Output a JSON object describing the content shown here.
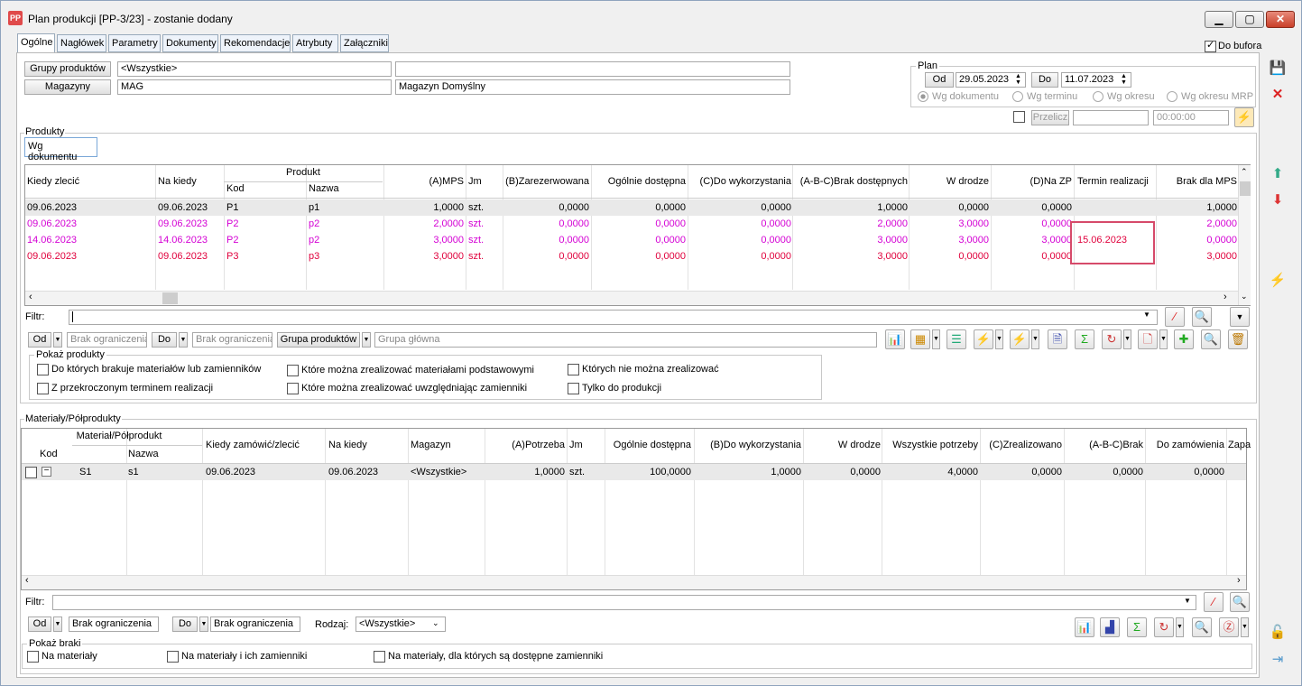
{
  "window": {
    "title": "Plan produkcji [PP-3/23] - zostanie dodany",
    "icon_text": "PP"
  },
  "tabs": [
    "Ogólne",
    "Nagłówek",
    "Parametry",
    "Dokumenty",
    "Rekomendacje",
    "Atrybuty",
    "Załączniki"
  ],
  "do_bufora": "Do bufora",
  "top": {
    "grupy_btn": "Grupy produktów",
    "grupy_val": "<Wszystkie>",
    "grupy_desc": "",
    "magazyny_btn": "Magazyny",
    "magazyny_val": "MAG",
    "magazyny_desc": "Magazyn Domyślny"
  },
  "plan": {
    "label": "Plan",
    "od_btn": "Od",
    "od_date": "29.05.2023",
    "do_btn": "Do",
    "do_date": "11.07.2023",
    "radios": [
      "Wg dokumentu",
      "Wg terminu",
      "Wg okresu",
      "Wg okresu MRP"
    ],
    "przelicz": "Przelicz",
    "time": "00:00:00"
  },
  "produkty": {
    "label": "Produkty",
    "subtab": "Wg dokumentu",
    "headers": {
      "kiedy": "Kiedy zlecić",
      "na_kiedy": "Na kiedy",
      "produkt": "Produkt",
      "kod": "Kod",
      "nazwa": "Nazwa",
      "amps": "(A)MPS",
      "jm": "Jm",
      "zarez": "(B)Zarezerwowana",
      "ogolnie": "Ogólnie dostępna",
      "dowyk": "(C)Do wykorzystania",
      "abc": "(A-B-C)Brak dostępnych",
      "wdrodze": "W drodze",
      "nazp": "(D)Na ZP",
      "termin": "Termin realizacji",
      "brak": "Brak dla MPS"
    },
    "rows": [
      {
        "kiedy": "09.06.2023",
        "na_kiedy": "09.06.2023",
        "kod": "P1",
        "nazwa": "p1",
        "amps": "1,0000",
        "jm": "szt.",
        "zarez": "0,0000",
        "ogolnie": "0,0000",
        "dowyk": "0,0000",
        "abc": "1,0000",
        "wdrodze": "0,0000",
        "nazp": "0,0000",
        "termin": "",
        "brak": "1,0000",
        "color": "#000000"
      },
      {
        "kiedy": "09.06.2023",
        "na_kiedy": "09.06.2023",
        "kod": "P2",
        "nazwa": "p2",
        "amps": "2,0000",
        "jm": "szt.",
        "zarez": "0,0000",
        "ogolnie": "0,0000",
        "dowyk": "0,0000",
        "abc": "2,0000",
        "wdrodze": "3,0000",
        "nazp": "0,0000",
        "termin": "",
        "brak": "2,0000",
        "color": "#d400d4"
      },
      {
        "kiedy": "14.06.2023",
        "na_kiedy": "14.06.2023",
        "kod": "P2",
        "nazwa": "p2",
        "amps": "3,0000",
        "jm": "szt.",
        "zarez": "0,0000",
        "ogolnie": "0,0000",
        "dowyk": "0,0000",
        "abc": "3,0000",
        "wdrodze": "3,0000",
        "nazp": "3,0000",
        "termin": "15.06.2023",
        "brak": "0,0000",
        "color": "#d400d4"
      },
      {
        "kiedy": "09.06.2023",
        "na_kiedy": "09.06.2023",
        "kod": "P3",
        "nazwa": "p3",
        "amps": "3,0000",
        "jm": "szt.",
        "zarez": "0,0000",
        "ogolnie": "0,0000",
        "dowyk": "0,0000",
        "abc": "3,0000",
        "wdrodze": "0,0000",
        "nazp": "0,0000",
        "termin": "",
        "brak": "3,0000",
        "color": "#e0003c"
      }
    ],
    "filtr": "Filtr:",
    "od": "Od",
    "od_ph": "Brak ograniczenia",
    "do": "Do",
    "do_ph": "Brak ograniczenia",
    "grupa_btn": "Grupa produktów",
    "grupa_val": "Grupa główna",
    "pokaz": "Pokaż produkty",
    "checks": [
      "Do których brakuje materiałów lub zamienników",
      "Z przekroczonym terminem realizacji",
      "Które można zrealizować materiałami podstawowymi",
      "Które można zrealizować uwzględniając zamienniki",
      "Których nie można zrealizować",
      "Tylko do produkcji"
    ]
  },
  "materialy": {
    "label": "Materiały/Półprodukty",
    "headers": {
      "matpol": "Materiał/Półprodukt",
      "kod": "Kod",
      "nazwa": "Nazwa",
      "kiedy": "Kiedy zamówić/zlecić",
      "na_kiedy": "Na kiedy",
      "magazyn": "Magazyn",
      "apotrz": "(A)Potrzeba",
      "jm": "Jm",
      "ogolnie": "Ogólnie dostępna",
      "bdowyk": "(B)Do wykorzystania",
      "wdrodze": "W drodze",
      "wszystkie": "Wszystkie potrzeby",
      "czreal": "(C)Zrealizowano",
      "abc": "(A-B-C)Brak",
      "dozam": "Do zamówienia",
      "zapas": "Zapa"
    },
    "rows": [
      {
        "kod": "S1",
        "nazwa": "s1",
        "kiedy": "09.06.2023",
        "na_kiedy": "09.06.2023",
        "magazyn": "<Wszystkie>",
        "apotrz": "1,0000",
        "jm": "szt.",
        "ogolnie": "100,0000",
        "bdowyk": "1,0000",
        "wdrodze": "0,0000",
        "wszystkie": "4,0000",
        "czreal": "0,0000",
        "abc": "0,0000",
        "dozam": "0,0000"
      }
    ],
    "filtr": "Filtr:",
    "od": "Od",
    "od_val": "Brak ograniczenia",
    "do": "Do",
    "do_val": "Brak ograniczenia",
    "rodzaj": "Rodzaj:",
    "rodzaj_val": "<Wszystkie>",
    "pokaz": "Pokaż braki",
    "checks": [
      "Na materiały",
      "Na materiały i ich zamienniki",
      "Na materiały, dla których są dostępne zamienniki"
    ]
  }
}
